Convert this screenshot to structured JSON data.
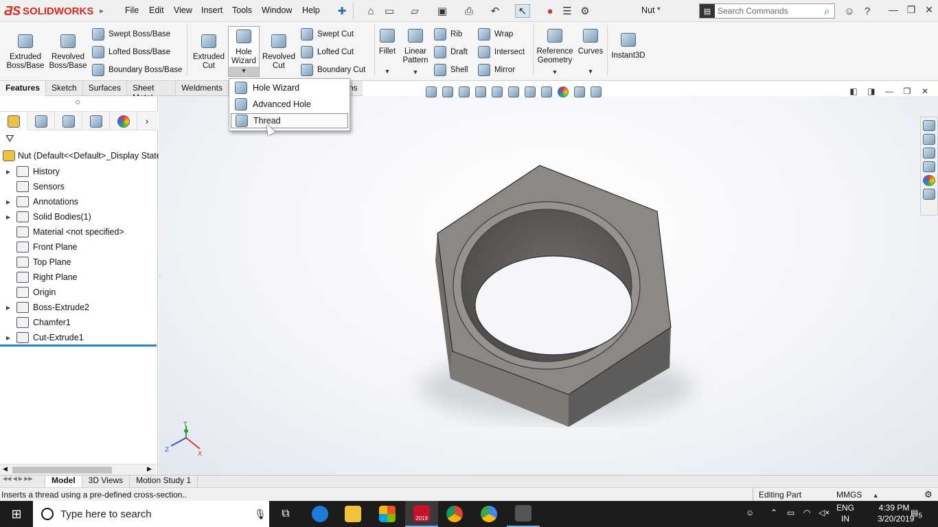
{
  "app": {
    "logo_text": "SOLIDWORKS",
    "document_title": "Nut *"
  },
  "menu": [
    "File",
    "Edit",
    "View",
    "Insert",
    "Tools",
    "Window",
    "Help"
  ],
  "search": {
    "placeholder": "Search Commands"
  },
  "ribbon": {
    "extruded_boss": "Extruded Boss/Base",
    "revolved_boss": "Revolved Boss/Base",
    "swept_boss": "Swept Boss/Base",
    "lofted_boss": "Lofted Boss/Base",
    "boundary_boss": "Boundary Boss/Base",
    "extruded_cut": "Extruded Cut",
    "hole_wizard": "Hole Wizard",
    "revolved_cut": "Revolved Cut",
    "swept_cut": "Swept Cut",
    "lofted_cut": "Lofted Cut",
    "boundary_cut": "Boundary Cut",
    "fillet": "Fillet",
    "linear_pattern": "Linear Pattern",
    "rib": "Rib",
    "draft": "Draft",
    "shell": "Shell",
    "wrap": "Wrap",
    "intersect": "Intersect",
    "mirror": "Mirror",
    "reference_geometry": "Reference Geometry",
    "curves": "Curves",
    "instant3d": "Instant3D"
  },
  "tabs": [
    "Features",
    "Sketch",
    "Surfaces",
    "Sheet Metal",
    "Weldments"
  ],
  "tabs_hidden_tail": "ns",
  "dropdown": [
    "Hole Wizard",
    "Advanced Hole",
    "Thread"
  ],
  "tree": {
    "root": "Nut  (Default<<Default>_Display State",
    "items": [
      {
        "label": "History",
        "expandable": true,
        "icon": "history-icon"
      },
      {
        "label": "Sensors",
        "expandable": false,
        "icon": "sensors-icon"
      },
      {
        "label": "Annotations",
        "expandable": true,
        "icon": "annotations-icon"
      },
      {
        "label": "Solid Bodies(1)",
        "expandable": true,
        "icon": "solid-bodies-icon"
      },
      {
        "label": "Material <not specified>",
        "expandable": false,
        "icon": "material-icon"
      },
      {
        "label": "Front Plane",
        "expandable": false,
        "icon": "plane-icon"
      },
      {
        "label": "Top Plane",
        "expandable": false,
        "icon": "plane-icon"
      },
      {
        "label": "Right Plane",
        "expandable": false,
        "icon": "plane-icon"
      },
      {
        "label": "Origin",
        "expandable": false,
        "icon": "origin-icon"
      },
      {
        "label": "Boss-Extrude2",
        "expandable": true,
        "icon": "boss-extrude-icon"
      },
      {
        "label": "Chamfer1",
        "expandable": false,
        "icon": "chamfer-icon"
      },
      {
        "label": "Cut-Extrude1",
        "expandable": true,
        "icon": "cut-extrude-icon"
      }
    ]
  },
  "triad": {
    "x": "X",
    "y": "Y",
    "z": "Z"
  },
  "bottom_tabs": [
    "Model",
    "3D Views",
    "Motion Study 1"
  ],
  "status": {
    "message": "Inserts a thread using a pre-defined cross-section..",
    "mode": "Editing Part",
    "units": "MMGS"
  },
  "taskbar": {
    "search_placeholder": "Type here to search",
    "lang_top": "ENG",
    "lang_bottom": "IN",
    "time": "4:39 PM",
    "date": "3/20/2019",
    "notifications": "5",
    "sw_badge": "2019"
  },
  "colors": {
    "accent": "#da291c",
    "tree_underline": "#2d7fd3",
    "nut": "#8c8883"
  }
}
